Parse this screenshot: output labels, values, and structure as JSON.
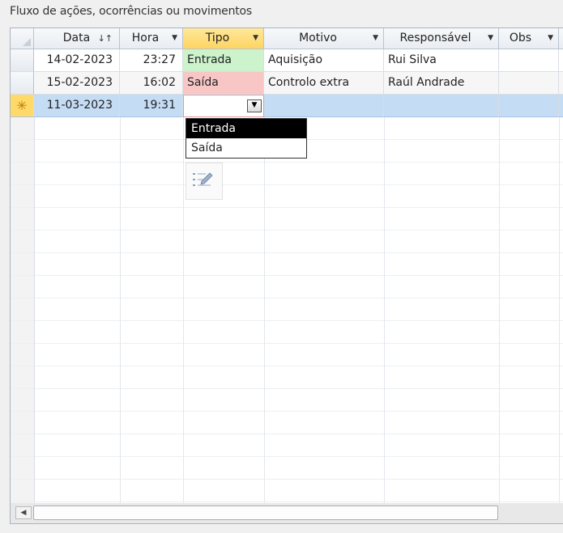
{
  "section": {
    "title": "Fluxo de ações, ocorrências ou movimentos"
  },
  "columns": [
    {
      "label": "Data",
      "sort": "↓↑"
    },
    {
      "label": "Hora"
    },
    {
      "label": "Tipo"
    },
    {
      "label": "Motivo"
    },
    {
      "label": "Responsável"
    },
    {
      "label": "Obs"
    }
  ],
  "rows": [
    {
      "data": "14-02-2023",
      "hora": "23:27",
      "tipo": "Entrada",
      "motivo": "Aquisição",
      "responsavel": "Rui Silva",
      "obs": ""
    },
    {
      "data": "15-02-2023",
      "hora": "16:02",
      "tipo": "Saída",
      "motivo": "Controlo extra",
      "responsavel": "Raúl Andrade",
      "obs": ""
    }
  ],
  "new_row": {
    "marker": "✳",
    "data": "11-03-2023",
    "hora": "19:31",
    "tipo": ""
  },
  "tipo_options": [
    "Entrada",
    "Saída"
  ],
  "colors": {
    "entrada": "#ccf3cc",
    "saida": "#f9c6c6",
    "selected_row": "#c5dcf5",
    "active_header": "#fdd462"
  }
}
